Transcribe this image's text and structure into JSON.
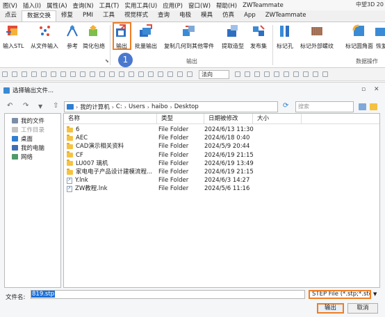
{
  "app": {
    "title_right": "中望3D 20"
  },
  "menu": [
    "图(V)",
    "插入(I)",
    "属性(A)",
    "查询(N)",
    "工具(T)",
    "实用工具(U)",
    "应用(P)",
    "窗口(W)",
    "帮助(H)",
    "ZWTeammate"
  ],
  "tabs": [
    {
      "label": "点云",
      "active": false
    },
    {
      "label": "数据交换",
      "active": true
    },
    {
      "label": "修复",
      "active": false
    },
    {
      "label": "PMI",
      "active": false
    },
    {
      "label": "工具",
      "active": false
    },
    {
      "label": "视觉样式",
      "active": false
    },
    {
      "label": "查询",
      "active": false
    },
    {
      "label": "电极",
      "active": false
    },
    {
      "label": "模具",
      "active": false
    },
    {
      "label": "仿真",
      "active": false
    },
    {
      "label": "App",
      "active": false
    },
    {
      "label": "ZWTeammate",
      "active": false
    }
  ],
  "ribbon": {
    "buttons": [
      {
        "label": "输入STL",
        "icon": "import-stl-icon"
      },
      {
        "label": "从文件输入",
        "icon": "import-from-file-icon"
      },
      {
        "label": "参考",
        "icon": "reference-icon"
      },
      {
        "label": "简化包络",
        "icon": "simplify-envelope-icon"
      },
      {
        "label": "输出",
        "icon": "export-icon"
      },
      {
        "label": "批量输出",
        "icon": "batch-export-icon"
      },
      {
        "label": "复制几何到其他零件",
        "icon": "copy-geometry-icon"
      },
      {
        "label": "提取造型",
        "icon": "extract-shape-icon"
      },
      {
        "label": "发布集",
        "icon": "publish-set-icon"
      },
      {
        "label": "标记孔",
        "icon": "mark-hole-icon"
      },
      {
        "label": "标记外部螺纹",
        "icon": "mark-external-thread-icon"
      },
      {
        "label": "标记圆角面",
        "icon": "mark-fillet-face-icon"
      },
      {
        "label": "恢复",
        "icon": "restore-icon"
      }
    ],
    "group_export": "输出",
    "group_data_ops": "数据操作"
  },
  "quickbar": {
    "direction_label": "法向"
  },
  "badges": [
    "1",
    "2",
    "3"
  ],
  "dialog": {
    "title": "选择输出文件...",
    "address": [
      "我的计算机",
      "C:",
      "Users",
      "haibo",
      "Desktop"
    ],
    "search_placeholder": "搜索",
    "sidebar": [
      {
        "label": "我的文件",
        "disabled": false,
        "color": "#7a8ea8"
      },
      {
        "label": "工作目录",
        "disabled": true,
        "color": "#c4c4c4"
      },
      {
        "label": "桌面",
        "disabled": false,
        "color": "#2f7fd1"
      },
      {
        "label": "我的电脑",
        "disabled": false,
        "color": "#3e6fb5"
      },
      {
        "label": "网络",
        "disabled": false,
        "color": "#4f9a6b"
      }
    ],
    "columns": [
      "名称",
      "类型",
      "日期被修改",
      "大小"
    ],
    "files": [
      {
        "name": "6",
        "type": "File Folder",
        "date": "2024/6/13 11:30",
        "kind": "folder"
      },
      {
        "name": "AEC",
        "type": "File Folder",
        "date": "2024/6/18 0:40",
        "kind": "folder"
      },
      {
        "name": "CAD演示相关资料",
        "type": "File Folder",
        "date": "2024/5/9 20:44",
        "kind": "folder"
      },
      {
        "name": "CF",
        "type": "File Folder",
        "date": "2024/6/19 21:15",
        "kind": "folder"
      },
      {
        "name": "LU007 璃机",
        "type": "File Folder",
        "date": "2024/6/19 13:49",
        "kind": "folder"
      },
      {
        "name": "家电电子产品设计建模流程...",
        "type": "File Folder",
        "date": "2024/6/19 21:15",
        "kind": "folder"
      },
      {
        "name": "Y.lnk",
        "type": "File Folder",
        "date": "2024/6/3 14:27",
        "kind": "link"
      },
      {
        "name": "ZW教程.lnk",
        "type": "File Folder",
        "date": "2024/5/6 11:16",
        "kind": "link"
      }
    ],
    "filename_label": "文件名:",
    "filename_value": "819.stp",
    "filetype_value": "STEP File (*.stp;*.step)",
    "export_button": "输出",
    "cancel_button": "取消"
  },
  "colors": {
    "highlight": "#ef7d22",
    "badge": "#4a78d0",
    "selection": "#1c6fd6"
  }
}
